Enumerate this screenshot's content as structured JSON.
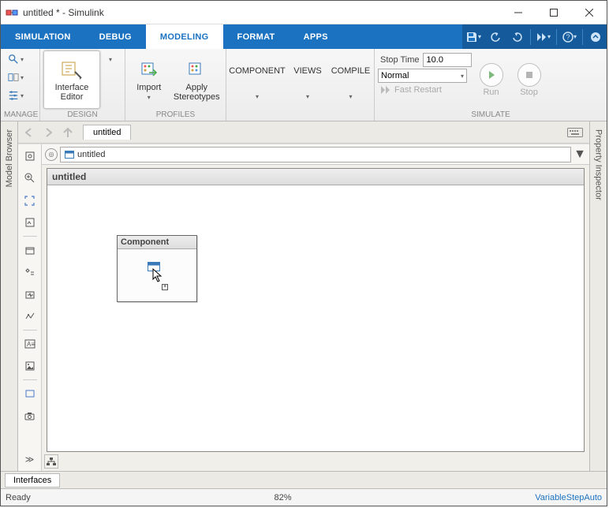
{
  "window": {
    "title": "untitled * - Simulink"
  },
  "tabs": {
    "simulation": "SIMULATION",
    "debug": "DEBUG",
    "modeling": "MODELING",
    "format": "FORMAT",
    "apps": "APPS"
  },
  "ribbon": {
    "manage": {
      "label": "MANAGE"
    },
    "design": {
      "label": "DESIGN",
      "interface_editor": "Interface\nEditor"
    },
    "profiles": {
      "label": "PROFILES",
      "import": "Import",
      "apply_stereo": "Apply\nStereotypes"
    },
    "component": {
      "label": "COMPONENT"
    },
    "views": {
      "label": "VIEWS"
    },
    "compile": {
      "label": "COMPILE"
    },
    "simulate": {
      "label": "SIMULATE",
      "stop_time_label": "Stop Time",
      "stop_time_value": "10.0",
      "mode": "Normal",
      "fast_restart": "Fast Restart",
      "run": "Run",
      "stop": "Stop"
    }
  },
  "nav": {
    "crumb": "untitled"
  },
  "addr": {
    "model": "untitled"
  },
  "canvas": {
    "sheet_title": "untitled",
    "component_label": "Component"
  },
  "side": {
    "left": "Model Browser",
    "right": "Property Inspector"
  },
  "bottom_tab": "Interfaces",
  "status": {
    "left": "Ready",
    "center": "82%",
    "right": "VariableStepAuto"
  }
}
